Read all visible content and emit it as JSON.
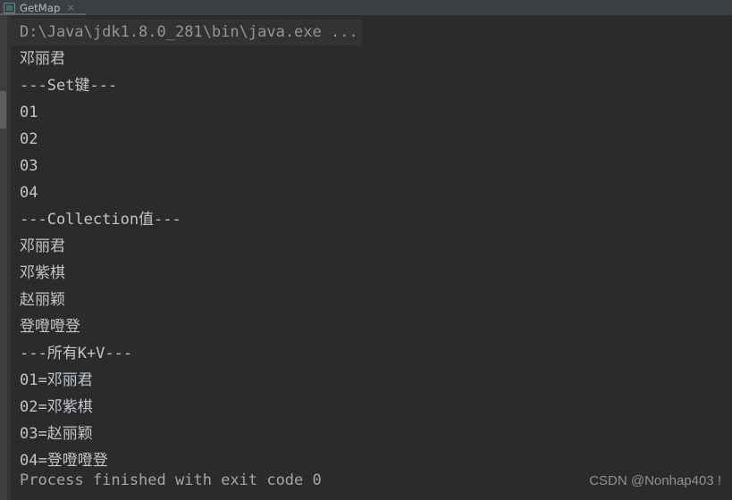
{
  "window": {
    "tab": {
      "label": "GetMap",
      "close_glyph": "×",
      "icon": "application-run-icon"
    }
  },
  "console": {
    "command_line": "D:\\Java\\jdk1.8.0_281\\bin\\java.exe ...",
    "output_lines": [
      "邓丽君",
      "---Set键---",
      "01",
      "02",
      "03",
      "04",
      "---Collection值---",
      "邓丽君",
      "邓紫棋",
      "赵丽颖",
      "登噔噔登",
      "---所有K+V---",
      "01=邓丽君",
      "02=邓紫棋",
      "03=赵丽颖",
      "04=登噔噔登"
    ],
    "exit_line": "Process finished with exit code 0"
  },
  "watermark": {
    "text": "CSDN @Nonhap403 !"
  },
  "colors": {
    "console_background": "#2b2b2b",
    "tabbar_background": "#3c3f41",
    "gutter_background": "#3c3f41",
    "command_background": "#323232",
    "output_text": "#bfc6cc",
    "command_text": "#919699",
    "tab_label_text": "#bbbbbb",
    "tab_icon_accent": "#356f78",
    "watermark_text": "#8f9194"
  }
}
